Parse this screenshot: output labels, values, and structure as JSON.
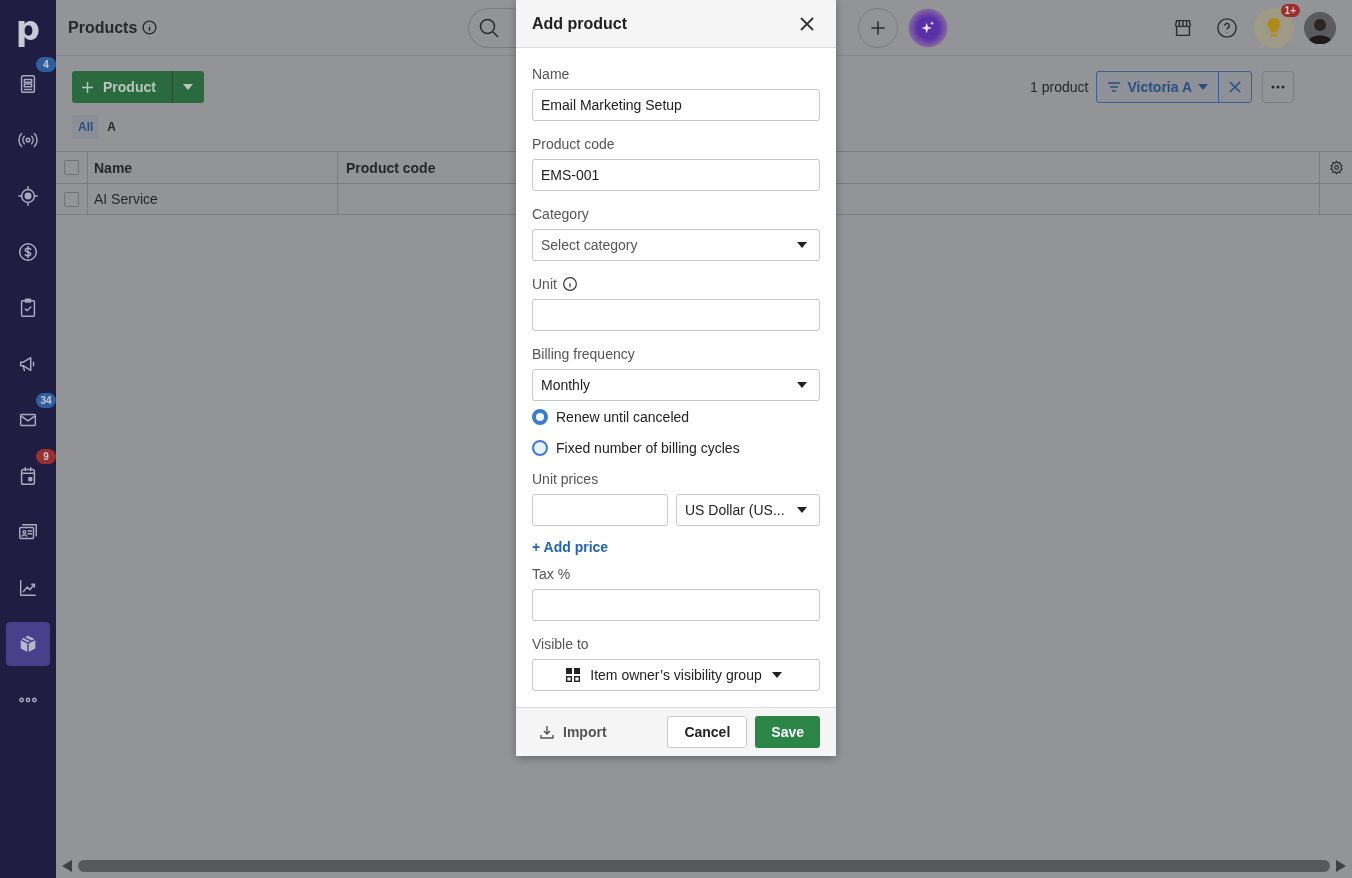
{
  "sidebar": {
    "logo": "p",
    "items": [
      {
        "kind": "deals",
        "selected": false,
        "badge": {
          "text": "4",
          "color": "#2f5f9e"
        }
      },
      {
        "kind": "leads",
        "selected": false
      },
      {
        "kind": "target",
        "selected": false
      },
      {
        "kind": "dollar",
        "selected": false
      },
      {
        "kind": "tasks",
        "selected": false
      },
      {
        "kind": "campaigns",
        "selected": false
      },
      {
        "kind": "mail",
        "selected": false,
        "badge": {
          "text": "34",
          "color": "#2f5f9e"
        }
      },
      {
        "kind": "calendar",
        "selected": false,
        "badge": {
          "text": "9",
          "color": "#9b2f2f"
        }
      },
      {
        "kind": "contacts",
        "selected": false
      },
      {
        "kind": "insights",
        "selected": false
      },
      {
        "kind": "products",
        "selected": true
      },
      {
        "kind": "more",
        "selected": false
      }
    ]
  },
  "topbar": {
    "title": "Products",
    "notification_badge": "1+"
  },
  "toolbar": {
    "add_button": "Product",
    "count": "1 product",
    "filter": "Victoria A"
  },
  "letter_tabs": [
    {
      "label": "All",
      "selected": true
    },
    {
      "label": "A",
      "selected": false
    }
  ],
  "table": {
    "columns": [
      "Name",
      "Product code"
    ],
    "rows": [
      {
        "checked": false,
        "cells": [
          "AI Service",
          ""
        ]
      }
    ],
    "header_checked": false
  },
  "modal": {
    "title": "Add product",
    "fields": [
      {
        "kind": "text",
        "label": "Name",
        "value": "Email Marketing Setup"
      },
      {
        "kind": "text",
        "label": "Product code",
        "value": "EMS-001"
      },
      {
        "kind": "select",
        "label": "Category",
        "placeholder": "Select category"
      },
      {
        "kind": "text",
        "label": "Unit",
        "info": true
      },
      {
        "kind": "select",
        "label": "Billing frequency",
        "value": "Monthly"
      },
      {
        "kind": "radio",
        "options": [
          {
            "label": "Renew until canceled",
            "selected": true
          },
          {
            "label": "Fixed number of billing cycles",
            "selected": false
          }
        ]
      },
      {
        "kind": "price",
        "label": "Unit prices",
        "currency": "US Dollar (US...",
        "link": "+ Add price"
      },
      {
        "kind": "text",
        "label": "Tax %"
      },
      {
        "kind": "visibility",
        "label": "Visible to",
        "value": "Item owner’s visibility group"
      }
    ],
    "footer": {
      "import": "Import",
      "cancel": "Cancel",
      "save": "Save"
    }
  }
}
